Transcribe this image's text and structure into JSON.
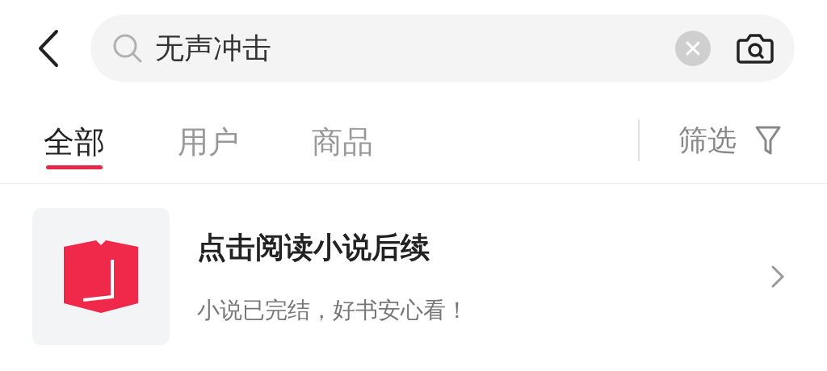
{
  "search": {
    "value": "无声冲击"
  },
  "tabs": [
    {
      "label": "全部",
      "selected": true
    },
    {
      "label": "用户",
      "selected": false
    },
    {
      "label": "商品",
      "selected": false
    }
  ],
  "filter": {
    "label": "筛选"
  },
  "result": {
    "title": "点击阅读小说后续",
    "subtitle": "小说已完结，好书安心看！"
  }
}
